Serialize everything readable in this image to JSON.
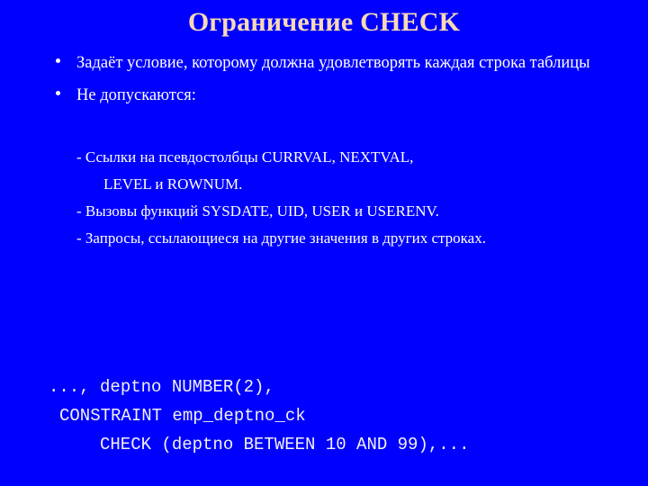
{
  "slide": {
    "background_color": "#0000FF",
    "title": "Ограничение CHECK",
    "title_color": "#F7D9B4",
    "body_text_color": "#FFFFFF",
    "code_text_color": "#F2F2F2",
    "bullet_glyph": "•"
  },
  "bullets": [
    {
      "text": "Задаёт условие, которому должна удовлетворять каждая строка таблицы"
    },
    {
      "text": "Не допускаются:"
    }
  ],
  "sub_items": [
    {
      "text": "- Ссылки на псевдостолбцы CURRVAL, NEXTVAL,"
    },
    {
      "text": "LEVEL и ROWNUM."
    },
    {
      "text": "- Вызовы функций SYSDATE, UID, USER и USERENV."
    },
    {
      "text": "- Запросы, ссылающиеся на другие значения в других строках."
    }
  ],
  "code": {
    "lines": [
      "..., deptno NUMBER(2),",
      "CONSTRAINT emp_deptno_ck",
      "CHECK (deptno BETWEEN 10 AND 99),..."
    ]
  }
}
